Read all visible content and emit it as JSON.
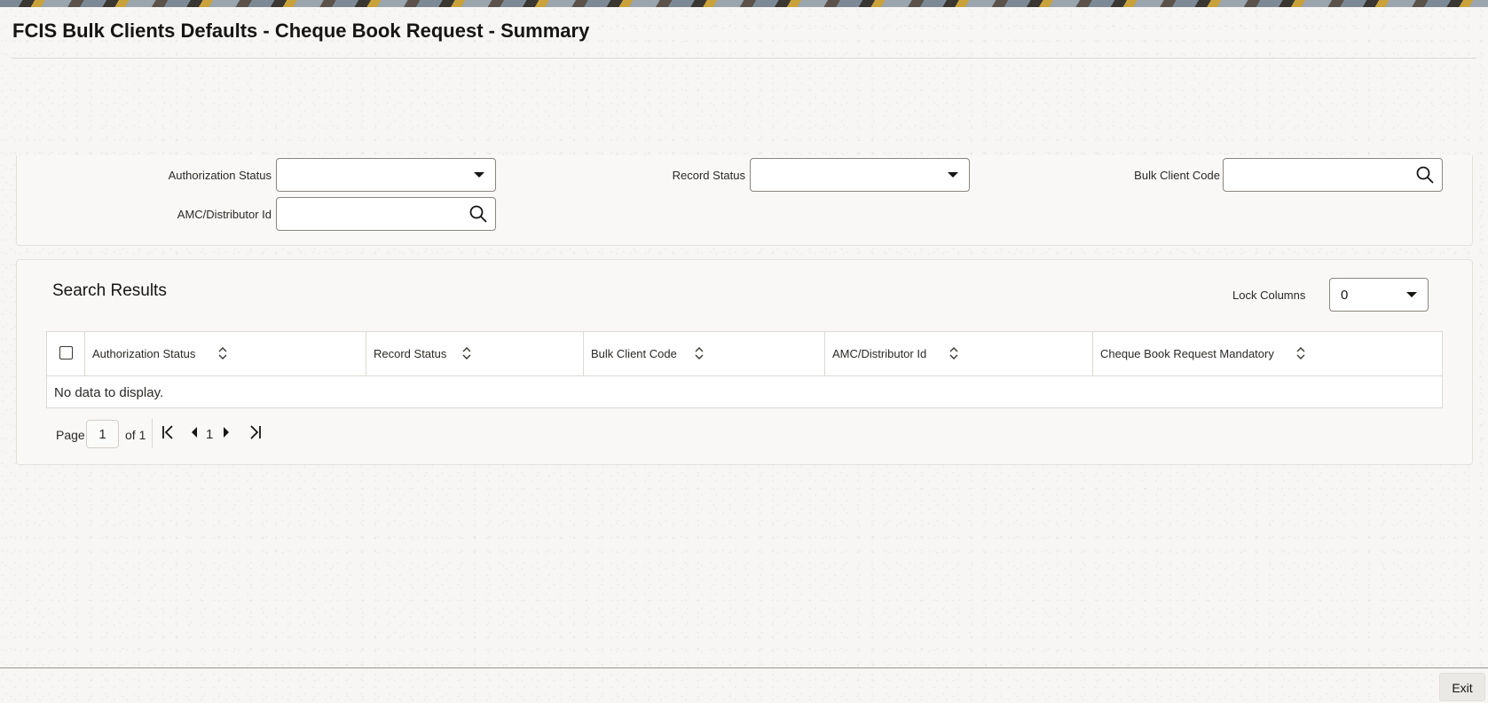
{
  "header": {
    "title": "FCIS Bulk Clients Defaults - Cheque Book Request - Summary"
  },
  "criteria": {
    "authorization_status": {
      "label": "Authorization Status",
      "value": ""
    },
    "record_status": {
      "label": "Record Status",
      "value": ""
    },
    "bulk_client_code": {
      "label": "Bulk Client Code",
      "value": ""
    },
    "amc_distributor_id": {
      "label": "AMC/Distributor Id",
      "value": ""
    }
  },
  "results": {
    "title": "Search Results",
    "lock_columns_label": "Lock Columns",
    "lock_columns_value": "0",
    "columns": [
      "Authorization Status",
      "Record Status",
      "Bulk Client Code",
      "AMC/Distributor Id",
      "Cheque Book Request Mandatory"
    ],
    "empty_text": "No data to display."
  },
  "pagination": {
    "page_label": "Page",
    "current_page": "1",
    "of_label": "of 1",
    "page_number": "1"
  },
  "footer": {
    "exit_label": "Exit"
  },
  "icons": {
    "dropdown": "chevron-down-icon",
    "lookup": "search-icon",
    "sort": "sort-icon",
    "first": "first-page-icon",
    "prev": "previous-page-icon",
    "next": "next-page-icon",
    "last": "last-page-icon"
  }
}
